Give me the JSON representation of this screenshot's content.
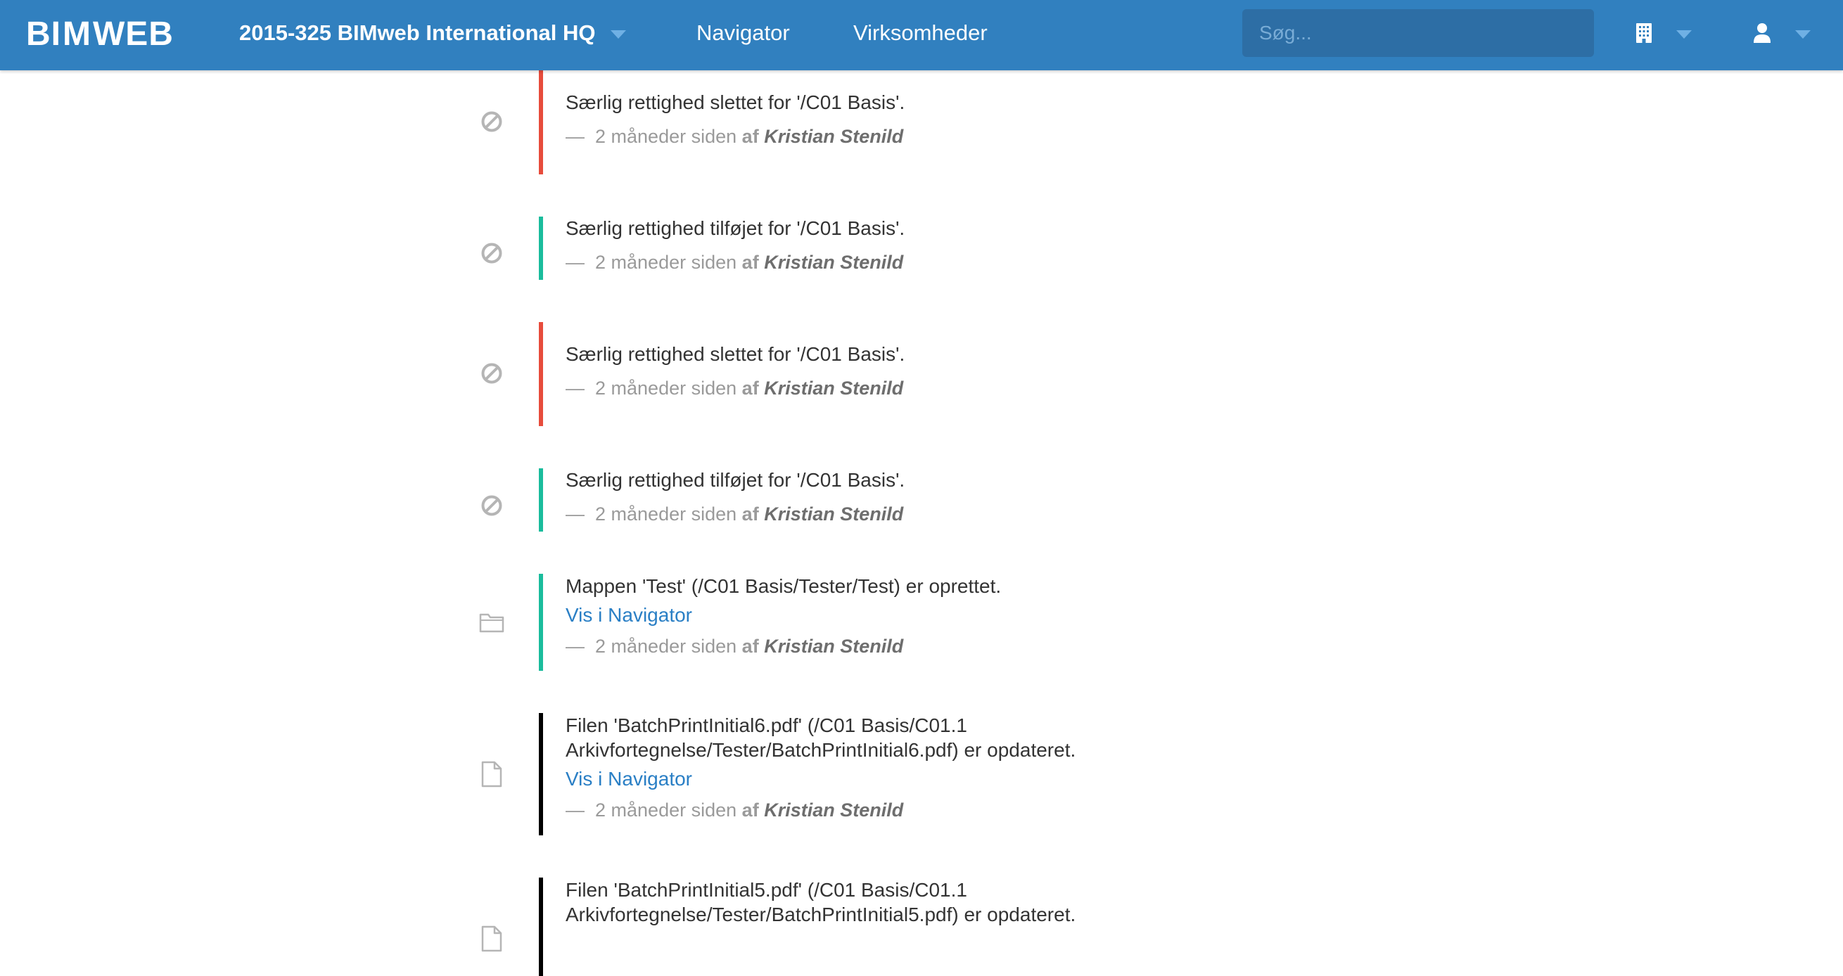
{
  "colors": {
    "topbar": "#3180bf",
    "search_bg": "#2d6ea5",
    "link": "#2a7fc5",
    "deleted_bar": "#e74c3c",
    "added_bar": "#1abc9c",
    "updated_bar": "#000000"
  },
  "header": {
    "logo_text_left": "BI",
    "logo_text_mark": "M",
    "logo_text_right": "WEB",
    "project_name": "2015-325 BIMweb International HQ",
    "nav": {
      "navigator": "Navigator",
      "virksomheder": "Virksomheder"
    },
    "search": {
      "placeholder": "Søg...",
      "icon": "search-field"
    },
    "company_menu_icon": "building-icon",
    "user_menu_icon": "user-icon"
  },
  "timeline": {
    "entries": [
      {
        "icon": "ban-icon",
        "status": "deleted",
        "message": "Særlig rettighed slettet for '/C01 Basis'.",
        "time": "2 måneder siden",
        "by": "af",
        "author": "Kristian Stenild"
      },
      {
        "icon": "ban-icon",
        "status": "added",
        "message": "Særlig rettighed tilføjet for '/C01 Basis'.",
        "time": "2 måneder siden",
        "by": "af",
        "author": "Kristian Stenild"
      },
      {
        "icon": "ban-icon",
        "status": "deleted",
        "message": "Særlig rettighed slettet for '/C01 Basis'.",
        "time": "2 måneder siden",
        "by": "af",
        "author": "Kristian Stenild"
      },
      {
        "icon": "ban-icon",
        "status": "added",
        "message": "Særlig rettighed tilføjet for '/C01 Basis'.",
        "time": "2 måneder siden",
        "by": "af",
        "author": "Kristian Stenild"
      },
      {
        "icon": "folder-icon",
        "status": "added",
        "message": "Mappen 'Test' (/C01 Basis/Tester/Test) er oprettet.",
        "link": "Vis i Navigator",
        "time": "2 måneder siden",
        "by": "af",
        "author": "Kristian Stenild"
      },
      {
        "icon": "file-icon",
        "status": "updated",
        "message": "Filen 'BatchPrintInitial6.pdf' (/C01 Basis/C01.1 Arkivfortegnelse/Tester/BatchPrintInitial6.pdf) er opdateret.",
        "link": "Vis i Navigator",
        "time": "2 måneder siden",
        "by": "af",
        "author": "Kristian Stenild"
      },
      {
        "icon": "file-icon",
        "status": "updated",
        "message": "Filen 'BatchPrintInitial5.pdf' (/C01 Basis/C01.1 Arkivfortegnelse/Tester/BatchPrintInitial5.pdf) er opdateret."
      }
    ]
  }
}
